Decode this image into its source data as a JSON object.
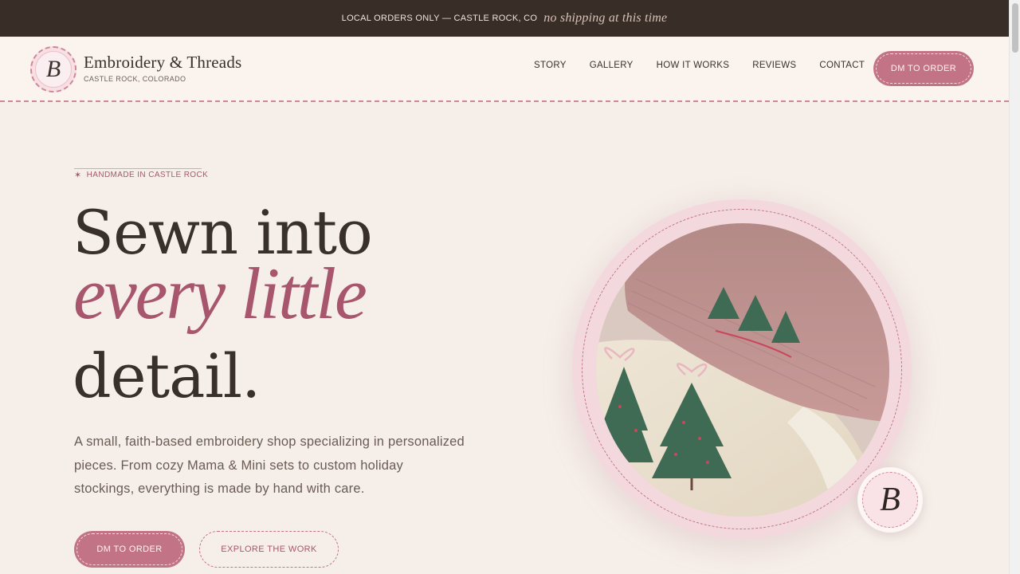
{
  "announcement": {
    "text": "LOCAL ORDERS ONLY — CASTLE ROCK, CO",
    "script": "no shipping at this time"
  },
  "brand": {
    "monogram": "B",
    "name": "Embroidery & Threads",
    "location": "CASTLE ROCK, COLORADO"
  },
  "nav": {
    "items": [
      {
        "label": "STORY"
      },
      {
        "label": "GALLERY"
      },
      {
        "label": "HOW IT WORKS"
      },
      {
        "label": "REVIEWS"
      },
      {
        "label": "CONTACT"
      }
    ],
    "cta_label": "DM TO ORDER"
  },
  "hero": {
    "eyebrow": "HANDMADE IN CASTLE ROCK",
    "heading_line1": "Sewn into",
    "heading_line2": "every little",
    "heading_line3": "detail.",
    "lede": "A small, faith-based embroidery shop specializing in personalized pieces. From cozy Mama & Mini sets to custom holiday stockings, everything is made by hand with care.",
    "primary_cta": "DM TO ORDER",
    "secondary_cta": "EXPLORE THE WORK",
    "badge_monogram": "B"
  },
  "colors": {
    "accent": "#c27486",
    "accent_text": "#a8566d",
    "dark": "#392d28",
    "background": "#f6efe9"
  }
}
